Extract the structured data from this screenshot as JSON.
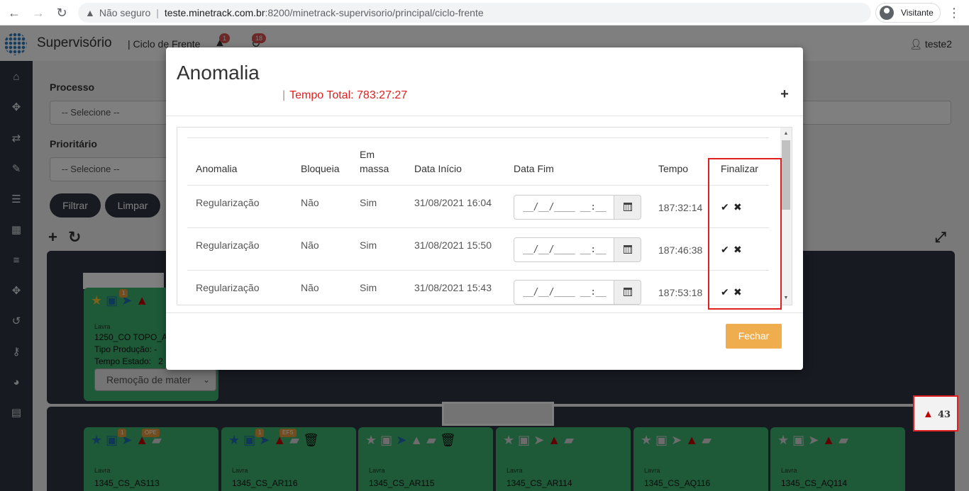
{
  "browser": {
    "security_label": "Não seguro",
    "url_host": "teste.minetrack.com.br",
    "url_path": ":8200/minetrack-supervisorio/principal/ciclo-frente",
    "profile_label": "Visitante"
  },
  "header": {
    "title": "Supervisório",
    "subtitle": "Ciclo de Frente",
    "alert_count": "1",
    "refresh_count": "18",
    "user": "teste2"
  },
  "filters": {
    "processo_label": "Processo",
    "processo_value": "-- Selecione --",
    "prioritario_label": "Prioritário",
    "prioritario_value": "-- Selecione --",
    "filtrar_label": "Filtrar",
    "limpar_label": "Limpar"
  },
  "top_card": {
    "count_badge": "1",
    "area": "Lavra",
    "name": "1250_CO TOPO_AR",
    "tipo_producao": "Tipo Produção: -",
    "tempo_estado": "Tempo Estado:",
    "tempo_estado_value": "2",
    "select_value": "Remoção de mater"
  },
  "bottom_alert": {
    "count": "43"
  },
  "cards": [
    {
      "area": "Lavra",
      "name": "1345_CS_AS113",
      "count_badge": "1",
      "status_badge": "OPE"
    },
    {
      "area": "Lavra",
      "name": "1345_CS_AR116",
      "count_badge": "1",
      "status_badge": "EFS"
    },
    {
      "area": "Lavra",
      "name": "1345_CS_AR115"
    },
    {
      "area": "Lavra",
      "name": "1345_CS_AR114"
    },
    {
      "area": "Lavra",
      "name": "1345_CS_AQ116"
    },
    {
      "area": "Lavra",
      "name": "1345_CS_AQ114"
    }
  ],
  "modal": {
    "title": "Anomalia",
    "total_label": "Tempo Total: 783:27:27",
    "columns": {
      "anomalia": "Anomalia",
      "bloqueia": "Bloqueia",
      "em_massa_1": "Em",
      "em_massa_2": "massa",
      "data_inicio": "Data Início",
      "data_fim": "Data Fim",
      "tempo": "Tempo",
      "finalizar": "Finalizar"
    },
    "rows": [
      {
        "anomalia": "Regularização",
        "bloqueia": "Não",
        "em_massa": "Sim",
        "data_inicio": "31/08/2021 16:04",
        "data_fim_placeholder": "__/__/____ __:__",
        "tempo": "187:32:14"
      },
      {
        "anomalia": "Regularização",
        "bloqueia": "Não",
        "em_massa": "Sim",
        "data_inicio": "31/08/2021 15:50",
        "data_fim_placeholder": "__/__/____ __:__",
        "tempo": "187:46:38"
      },
      {
        "anomalia": "Regularização",
        "bloqueia": "Não",
        "em_massa": "Sim",
        "data_inicio": "31/08/2021 15:43",
        "data_fim_placeholder": "__/__/____ __:__",
        "tempo": "187:53:18"
      }
    ],
    "close_label": "Fechar"
  },
  "colors": {
    "sidebar": "#2e3540",
    "card_green": "#3cb371",
    "alert_red": "#e02020",
    "close_button": "#f0ad4e"
  }
}
